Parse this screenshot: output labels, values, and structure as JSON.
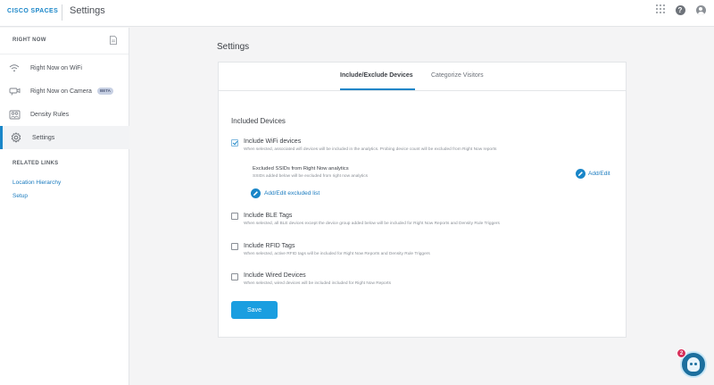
{
  "header": {
    "brand": "CISCO SPACES",
    "title": "Settings",
    "icons": [
      "apps-grid-icon",
      "help-icon",
      "user-avatar-icon"
    ]
  },
  "sidebar": {
    "section_label": "RIGHT NOW",
    "items": [
      {
        "label": "Right Now on WiFi",
        "icon": "wifi-icon"
      },
      {
        "label": "Right Now on Camera",
        "icon": "camera-icon",
        "badge": "BETA"
      },
      {
        "label": "Density Rules",
        "icon": "density-icon"
      },
      {
        "label": "Settings",
        "icon": "gear-icon",
        "active": true
      }
    ],
    "related_label": "RELATED LINKS",
    "links": [
      "Location Hierarchy",
      "Setup"
    ]
  },
  "main": {
    "page_title": "Settings",
    "tabs": [
      {
        "label": "Include/Exclude Devices",
        "active": true
      },
      {
        "label": "Categorize Visitors",
        "active": false
      }
    ],
    "section_title": "Included Devices",
    "options": [
      {
        "title": "Include WiFi devices",
        "desc": "When selected, associated wifi devices will be included in the analytics. Probing device count will be excluded from Right Now reports",
        "checked": true
      },
      {
        "title": "Include BLE Tags",
        "desc": "When selected, all BLE devices except the device group added below will be included for Right Now Reports and Density Rule Triggers",
        "checked": false
      },
      {
        "title": "Include RFID Tags",
        "desc": "When selected, active RFID tags will be included for Right Now Reports and Density Rule Triggers",
        "checked": false
      },
      {
        "title": "Include Wired Devices",
        "desc": "When selected, wired devices will be included included for Right Now Reports",
        "checked": false
      }
    ],
    "ssid": {
      "title": "Excluded SSIDs from Right Now analytics",
      "desc": "SSIDs added below will be excluded from right now analytics",
      "add_edit_label": "Add/Edit",
      "add_edit_list_label": "Add/Edit excluded list"
    },
    "save_label": "Save"
  },
  "assistant": {
    "notification_count": "2"
  },
  "colors": {
    "accent": "#1a86c8",
    "button": "#1a9ee0",
    "badge": "#d8315b"
  }
}
